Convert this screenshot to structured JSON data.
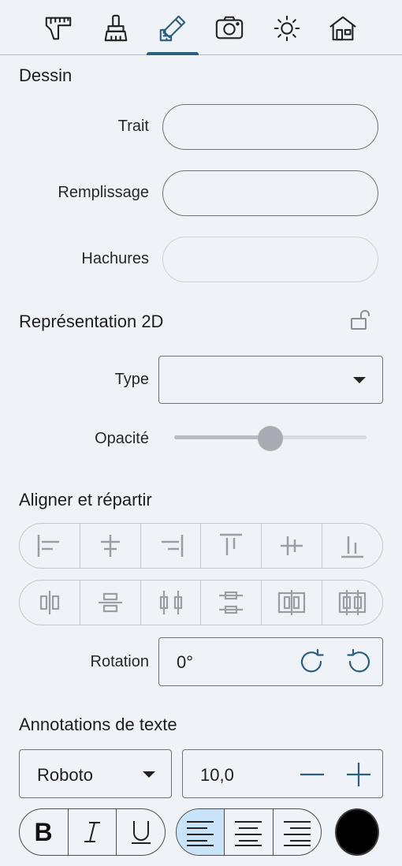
{
  "tabs": [
    {
      "icon": "caliper-icon"
    },
    {
      "icon": "brush-icon"
    },
    {
      "icon": "pencil-ruler-icon",
      "active": true
    },
    {
      "icon": "camera-icon"
    },
    {
      "icon": "sun-icon"
    },
    {
      "icon": "house-icon"
    }
  ],
  "dessin": {
    "title": "Dessin",
    "trait_label": "Trait",
    "remplissage_label": "Remplissage",
    "hachures_label": "Hachures"
  },
  "representation": {
    "title": "Représentation 2D",
    "type_label": "Type",
    "type_value": "",
    "opacity_label": "Opacité",
    "opacity_value": 0.5
  },
  "align": {
    "title": "Aligner et répartir",
    "row1": [
      "align-left-icon",
      "align-center-horizontal-icon",
      "align-right-icon",
      "align-top-icon",
      "align-middle-vertical-icon",
      "align-bottom-icon"
    ],
    "row2": [
      "distribute-horizontal-icon",
      "distribute-vertical-icon",
      "distribute-horizontal-space-icon",
      "distribute-vertical-space-icon",
      "distribute-horizontal-centers-icon",
      "distribute-horizontal-edges-icon"
    ]
  },
  "rotation": {
    "label": "Rotation",
    "value": "0°"
  },
  "annotations": {
    "title": "Annotations de texte",
    "font": "Roboto",
    "size": "10,0",
    "color": "#000000"
  },
  "colors": {
    "accent": "#2b5f7d",
    "active_segment": "#c9e3f8",
    "background": "#eff3f8"
  }
}
